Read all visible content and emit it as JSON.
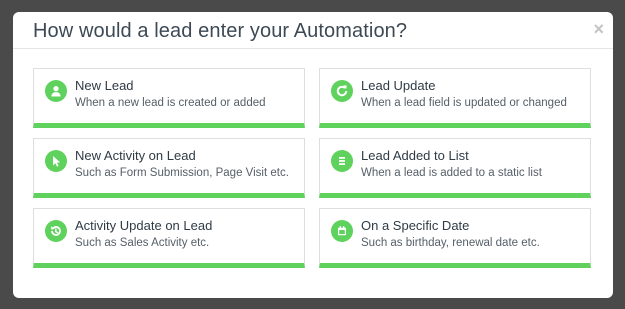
{
  "modal": {
    "title": "How would a lead enter your Automation?",
    "close_glyph": "×"
  },
  "accent_color": "#5ed25c",
  "options": [
    {
      "title": "New Lead",
      "description": "When a new lead is created or added",
      "icon": "person-icon"
    },
    {
      "title": "Lead Update",
      "description": "When a lead field is updated or changed",
      "icon": "refresh-icon"
    },
    {
      "title": "New Activity on Lead",
      "description": "Such as Form Submission, Page Visit etc.",
      "icon": "cursor-icon"
    },
    {
      "title": "Lead Added to List",
      "description": "When a lead is added to a static list",
      "icon": "list-icon"
    },
    {
      "title": "Activity Update on Lead",
      "description": "Such as Sales Activity etc.",
      "icon": "activity-update-icon"
    },
    {
      "title": "On a Specific Date",
      "description": "Such as birthday, renewal date etc.",
      "icon": "calendar-icon"
    }
  ]
}
